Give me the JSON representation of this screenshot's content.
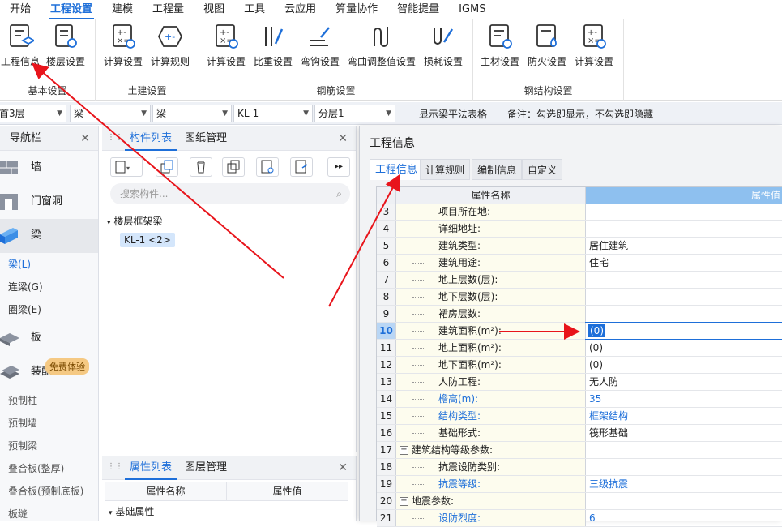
{
  "menu": [
    "开始",
    "工程设置",
    "建模",
    "工程量",
    "视图",
    "工具",
    "云应用",
    "算量协作",
    "智能提量",
    "IGMS"
  ],
  "ribbon": {
    "groups": [
      {
        "title": "基本设置",
        "buttons": [
          "工程信息",
          "楼层设置"
        ]
      },
      {
        "title": "土建设置",
        "buttons": [
          "计算设置",
          "计算规则"
        ]
      },
      {
        "title": "钢筋设置",
        "buttons": [
          "计算设置",
          "比重设置",
          "弯钩设置",
          "弯曲调整值设置",
          "损耗设置"
        ]
      },
      {
        "title": "钢结构设置",
        "buttons": [
          "主材设置",
          "防火设置",
          "计算设置"
        ]
      }
    ]
  },
  "filterbar": {
    "floor": "首3层",
    "type1": "梁",
    "type2": "梁",
    "comp": "KL-1",
    "layer": "分层1",
    "checkbox_label": "显示梁平法表格",
    "note": "备注：勾选即显示，不勾选即隐藏"
  },
  "nav": {
    "title": "导航栏",
    "items": [
      "墙",
      "门窗洞",
      "梁",
      "板",
      "装配式"
    ],
    "subitems_beam": [
      "梁(L)",
      "连梁(G)",
      "圈梁(E)"
    ],
    "subitems_bottom": [
      "预制柱",
      "预制墙",
      "预制梁",
      "叠合板(整厚)",
      "叠合板(预制底板)",
      "板缝"
    ],
    "trial_badge": "免费体验"
  },
  "component": {
    "tabs": [
      "构件列表",
      "图纸管理"
    ],
    "search_placeholder": "搜索构件...",
    "tree_root": "楼层框架梁",
    "tree_item": "KL-1 <2>"
  },
  "props": {
    "tabs": [
      "属性列表",
      "图层管理"
    ],
    "col_name": "属性名称",
    "col_value": "属性值",
    "basic": "基础属性"
  },
  "dialog": {
    "title": "工程信息",
    "tabs": [
      "工程信息",
      "计算规则",
      "编制信息",
      "自定义"
    ],
    "col_name": "属性名称",
    "col_value": "属性值",
    "rows": [
      {
        "n": "3",
        "name": "项目所在地:",
        "value": "",
        "blue": false
      },
      {
        "n": "4",
        "name": "详细地址:",
        "value": "",
        "blue": false
      },
      {
        "n": "5",
        "name": "建筑类型:",
        "value": "居住建筑",
        "blue": false
      },
      {
        "n": "6",
        "name": "建筑用途:",
        "value": "住宅",
        "blue": false
      },
      {
        "n": "7",
        "name": "地上层数(层):",
        "value": "",
        "blue": false
      },
      {
        "n": "8",
        "name": "地下层数(层):",
        "value": "",
        "blue": false
      },
      {
        "n": "9",
        "name": "裙房层数:",
        "value": "",
        "blue": false
      },
      {
        "n": "10",
        "name": "建筑面积(m²):",
        "value": "(0)",
        "blue": false
      },
      {
        "n": "11",
        "name": "地上面积(m²):",
        "value": "(0)",
        "blue": false
      },
      {
        "n": "12",
        "name": "地下面积(m²):",
        "value": "(0)",
        "blue": false
      },
      {
        "n": "13",
        "name": "人防工程:",
        "value": "无人防",
        "blue": false
      },
      {
        "n": "14",
        "name": "檐高(m):",
        "value": "35",
        "blue": true
      },
      {
        "n": "15",
        "name": "结构类型:",
        "value": "框架结构",
        "blue": true
      },
      {
        "n": "16",
        "name": "基础形式:",
        "value": "筏形基础",
        "blue": false
      },
      {
        "n": "17",
        "name": "建筑结构等级参数:",
        "value": "",
        "blue": false,
        "group": true
      },
      {
        "n": "18",
        "name": "抗震设防类别:",
        "value": "",
        "blue": false
      },
      {
        "n": "19",
        "name": "抗震等级:",
        "value": "三级抗震",
        "blue": true
      },
      {
        "n": "20",
        "name": "地震参数:",
        "value": "",
        "blue": false,
        "group": true
      },
      {
        "n": "21",
        "name": "设防烈度:",
        "value": "6",
        "blue": true
      }
    ]
  },
  "colors": {
    "accent": "#1e6fd9",
    "arrow": "#e8141b"
  }
}
